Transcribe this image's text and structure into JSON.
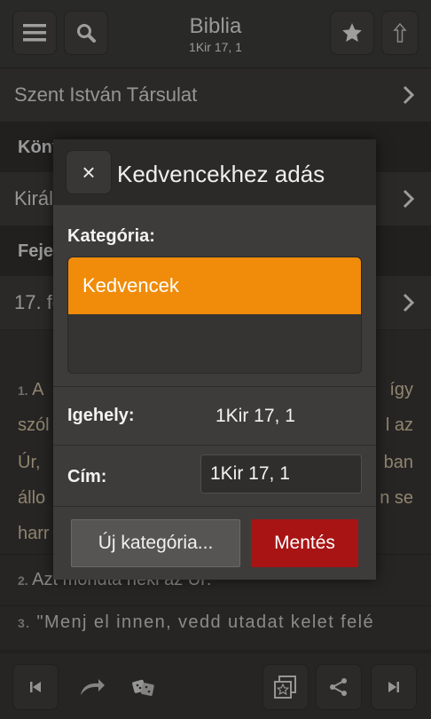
{
  "header": {
    "title": "Biblia",
    "subtitle": "1Kir 17, 1"
  },
  "rows": {
    "translation": "Szent István Társulat",
    "book_heading": "Könyv",
    "book": "Királyok I. könyve",
    "chapter_heading": "Fejezet",
    "chapter": "17. fejezet"
  },
  "verses": {
    "v1_num": "1.",
    "v1_lines": [
      "A",
      "szól",
      "Úr,",
      "állo",
      "harr"
    ],
    "v1_right": [
      "így",
      "l az",
      "ban",
      "n se"
    ],
    "v2_num": "2.",
    "v2_text": "Azt mondta neki az Úr:",
    "v3_num": "3.",
    "v3_text": "\"Menj el innen, vedd utadat kelet felé"
  },
  "dialog": {
    "title": "Kedvencekhez adás",
    "category_label": "Kategória:",
    "categories": [
      "Kedvencek"
    ],
    "location_label": "Igehely:",
    "location_value": "1Kir 17, 1",
    "title_label": "Cím:",
    "title_value": "1Kir 17, 1",
    "new_category_button": "Új kategória...",
    "save_button": "Mentés",
    "close_glyph": "×"
  },
  "colors": {
    "accent": "#f08c0a",
    "save": "#a81414"
  }
}
